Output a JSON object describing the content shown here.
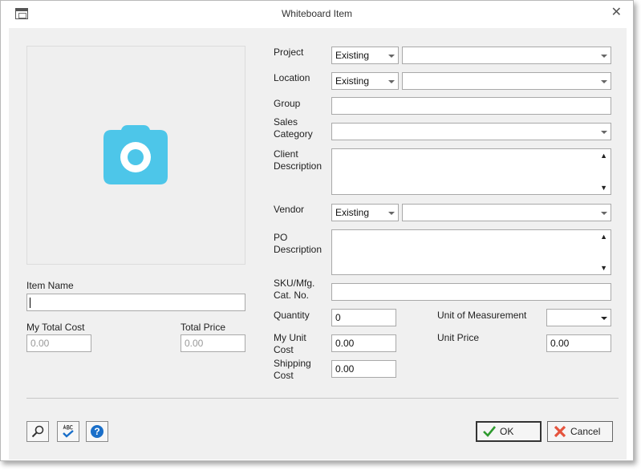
{
  "window": {
    "title": "Whiteboard Item"
  },
  "icons": {
    "app": "window-icon",
    "close": "close-icon",
    "photo": "camera-icon",
    "search": "magnifier-icon",
    "spellcheck": "spellcheck-icon",
    "help": "help-icon",
    "ok": "checkmark-icon",
    "cancel": "cross-icon"
  },
  "colors": {
    "camera": "#4dc6e9",
    "help": "#1a6fc9",
    "ok_check": "#2e9a2e",
    "cancel_cross": "#e5533d",
    "spell_check": "#1a6fc9"
  },
  "left": {
    "item_name": {
      "label": "Item Name",
      "value": ""
    },
    "my_total_cost": {
      "label": "My Total Cost",
      "value": "0.00"
    },
    "total_price": {
      "label": "Total Price",
      "value": "0.00"
    }
  },
  "right": {
    "project": {
      "label": "Project",
      "mode": "Existing",
      "value": ""
    },
    "location": {
      "label": "Location",
      "mode": "Existing",
      "value": ""
    },
    "group": {
      "label": "Group",
      "value": ""
    },
    "sales_category": {
      "label_line1": "Sales",
      "label_line2": "Category",
      "value": ""
    },
    "client_description": {
      "label_line1": "Client",
      "label_line2": "Description",
      "value": ""
    },
    "vendor": {
      "label": "Vendor",
      "mode": "Existing",
      "value": ""
    },
    "po_description": {
      "label_line1": "PO",
      "label_line2": "Description",
      "value": ""
    },
    "sku": {
      "label_line1": "SKU/Mfg.",
      "label_line2": "Cat. No.",
      "value": ""
    },
    "quantity": {
      "label": "Quantity",
      "value": "0"
    },
    "my_unit_cost": {
      "label_line1": "My Unit",
      "label_line2": "Cost",
      "value": "0.00"
    },
    "shipping_cost": {
      "label_line1": "Shipping",
      "label_line2": "Cost",
      "value": "0.00"
    },
    "unit_of_measurement": {
      "label": "Unit of Measurement",
      "value": ""
    },
    "unit_price": {
      "label": "Unit Price",
      "value": "0.00"
    }
  },
  "buttons": {
    "ok": "OK",
    "cancel": "Cancel"
  }
}
